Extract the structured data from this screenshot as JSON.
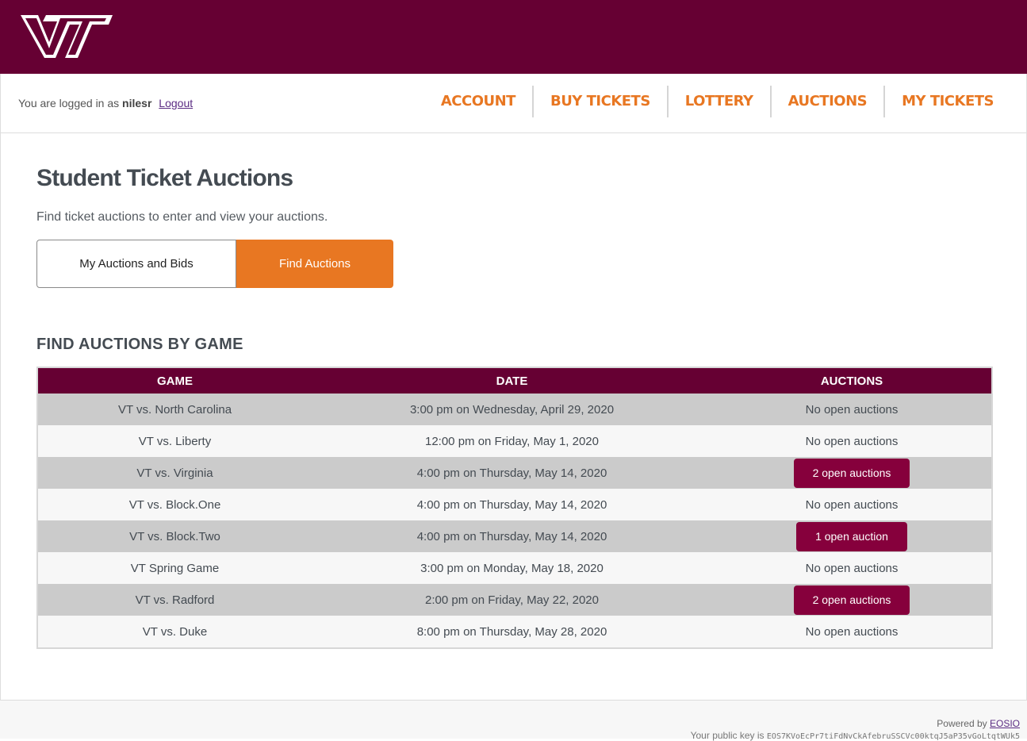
{
  "header": {
    "logo_text": "VT",
    "colors": {
      "banner": "#660033",
      "accent": "#e87722",
      "button": "#86003c"
    }
  },
  "nav": {
    "login_prefix": "You are logged in as",
    "username": "nilesr",
    "logout": "Logout",
    "links": [
      "ACCOUNT",
      "BUY TICKETS",
      "LOTTERY",
      "AUCTIONS",
      "MY TICKETS"
    ]
  },
  "main": {
    "title": "Student Ticket Auctions",
    "subtitle": "Find ticket auctions to enter and view your auctions.",
    "toggle": {
      "my_auctions": "My Auctions and Bids",
      "find_auctions": "Find Auctions",
      "selected": "Find Auctions"
    },
    "section_title": "FIND AUCTIONS BY GAME",
    "table": {
      "headers": [
        "GAME",
        "DATE",
        "AUCTIONS"
      ],
      "rows": [
        {
          "game": "VT vs. North Carolina",
          "date": "3:00 pm on Wednesday, April 29, 2020",
          "auctions": "No open auctions",
          "has_auctions": false
        },
        {
          "game": "VT vs. Liberty",
          "date": "12:00 pm on Friday, May 1, 2020",
          "auctions": "No open auctions",
          "has_auctions": false
        },
        {
          "game": "VT vs. Virginia",
          "date": "4:00 pm on Thursday, May 14, 2020",
          "auctions": "2 open auctions",
          "has_auctions": true
        },
        {
          "game": "VT vs. Block.One",
          "date": "4:00 pm on Thursday, May 14, 2020",
          "auctions": "No open auctions",
          "has_auctions": false
        },
        {
          "game": "VT vs. Block.Two",
          "date": "4:00 pm on Thursday, May 14, 2020",
          "auctions": "1 open auction",
          "has_auctions": true
        },
        {
          "game": "VT Spring Game",
          "date": "3:00 pm on Monday, May 18, 2020",
          "auctions": "No open auctions",
          "has_auctions": false
        },
        {
          "game": "VT vs. Radford",
          "date": "2:00 pm on Friday, May 22, 2020",
          "auctions": "2 open auctions",
          "has_auctions": true
        },
        {
          "game": "VT vs. Duke",
          "date": "8:00 pm on Thursday, May 28, 2020",
          "auctions": "No open auctions",
          "has_auctions": false
        }
      ]
    }
  },
  "footer": {
    "powered_by": "Powered by",
    "eosio": "EOSIO",
    "public_key_label": "Your public key is",
    "public_key": "EOS7KVoEcPr7tiFdNvCkAfebruSSCVc00ktqJ5aP35vGoLtqtWUk5"
  }
}
